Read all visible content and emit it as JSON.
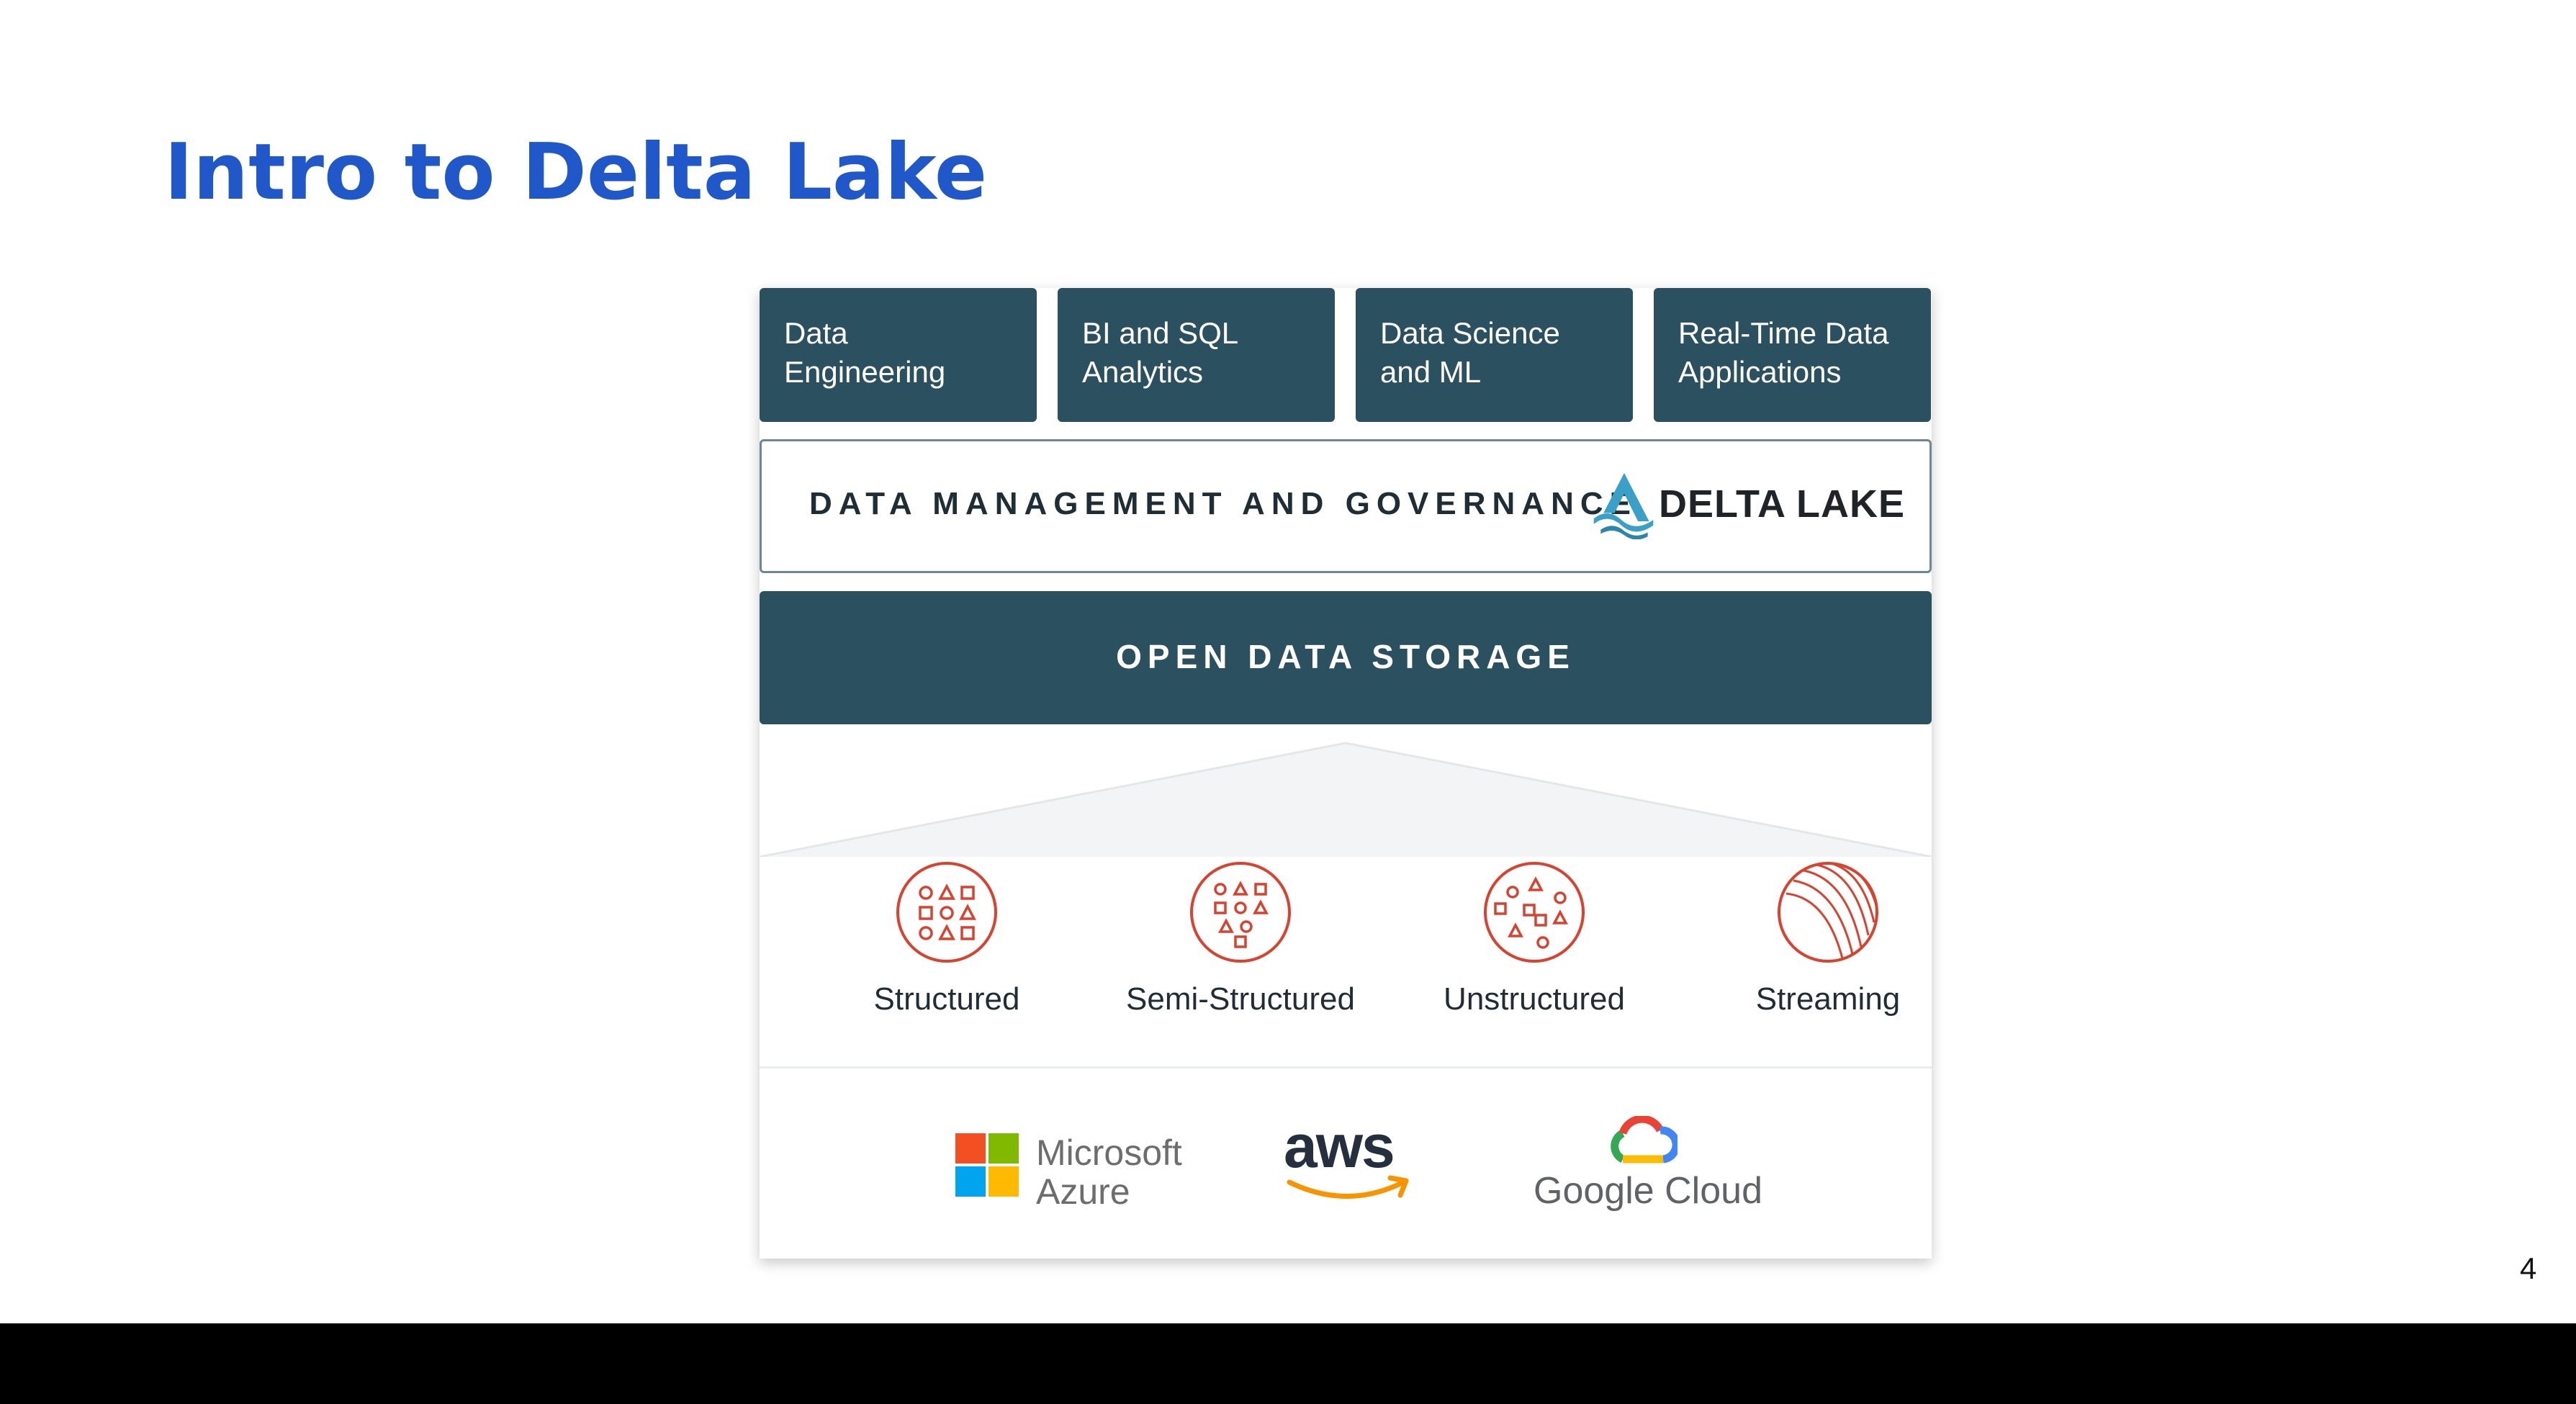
{
  "slide": {
    "title": "Intro to Delta Lake",
    "page_number": "4"
  },
  "workloads": [
    {
      "line1": "Data",
      "line2": "Engineering"
    },
    {
      "line1": "BI and SQL",
      "line2": "Analytics"
    },
    {
      "line1": "Data Science",
      "line2": "and ML"
    },
    {
      "line1": "Real-Time Data",
      "line2": "Applications"
    }
  ],
  "governance": {
    "label": "DATA MANAGEMENT AND GOVERNANCE",
    "brand": "DELTA LAKE"
  },
  "storage": {
    "label": "OPEN DATA STORAGE"
  },
  "data_types": [
    {
      "label": "Structured",
      "icon": "structured-data-icon"
    },
    {
      "label": "Semi-Structured",
      "icon": "semi-structured-data-icon"
    },
    {
      "label": "Unstructured",
      "icon": "unstructured-data-icon"
    },
    {
      "label": "Streaming",
      "icon": "streaming-data-icon"
    }
  ],
  "clouds": {
    "azure": {
      "line1": "Microsoft",
      "line2": "Azure"
    },
    "aws": {
      "text": "aws"
    },
    "google": {
      "text": "Google Cloud"
    }
  },
  "colors": {
    "title": "#2158c9",
    "tile": "#2b5060",
    "icon_accent": "#d9422f",
    "delta_logo": "#3aa0c8"
  }
}
